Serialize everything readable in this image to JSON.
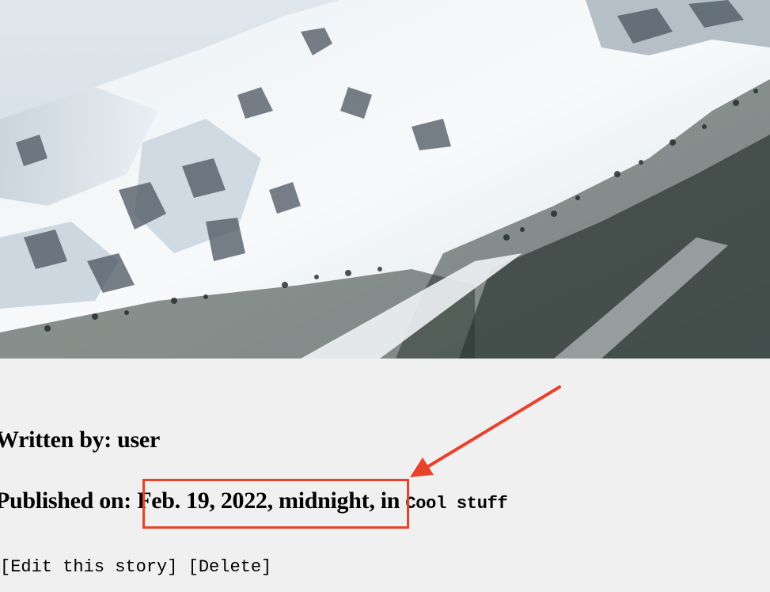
{
  "story": {
    "written_label": "Written by:",
    "author": "user",
    "published_label": "Published on:",
    "published_date": "Feb. 19, 2022, midnight",
    "in_label": ", in",
    "category": "Cool stuff",
    "actions": {
      "edit": "[Edit this story]",
      "delete": "[Delete]"
    }
  },
  "annotation": {
    "color": "#e8412c"
  }
}
